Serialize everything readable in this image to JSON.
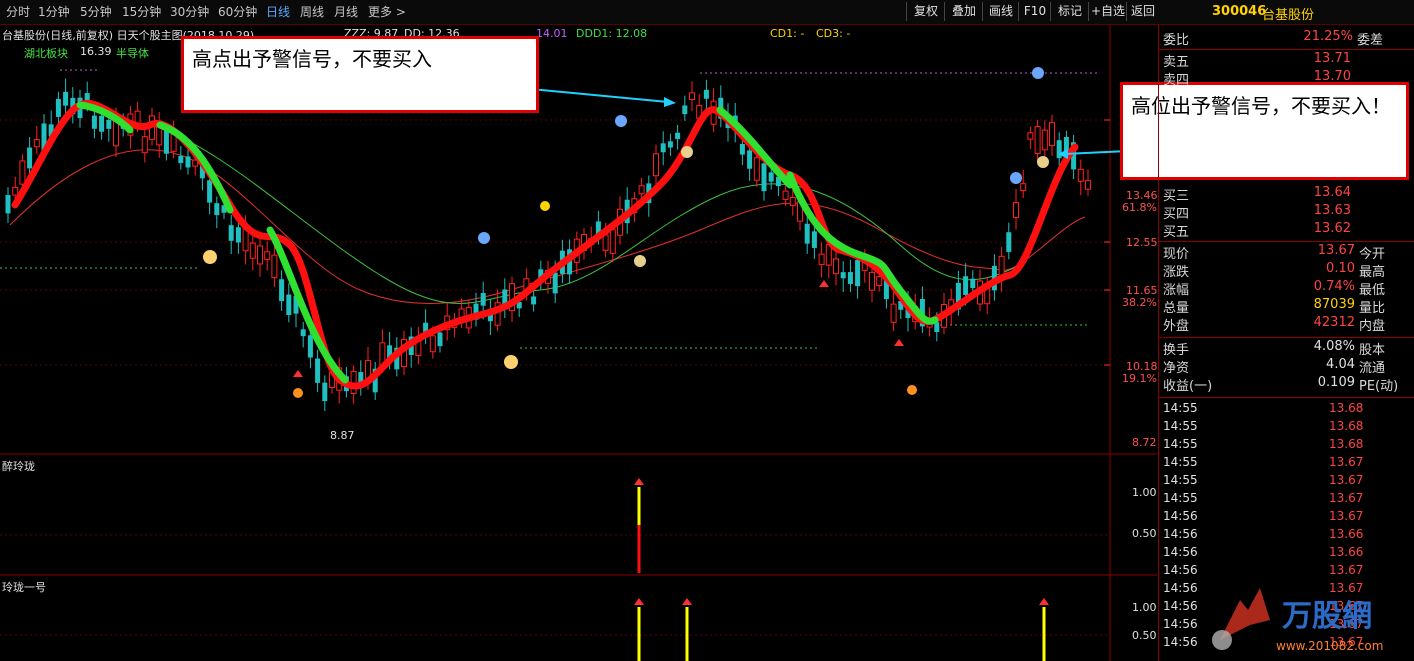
{
  "toolbar": {
    "periods": [
      "分时",
      "1分钟",
      "5分钟",
      "15分钟",
      "30分钟",
      "60分钟",
      "日线",
      "周线",
      "月线",
      "更多 >"
    ],
    "active_period": "日线",
    "buttons": [
      "复权",
      "叠加",
      "画线",
      "F10",
      "标记",
      "+自选",
      "返回"
    ]
  },
  "stock": {
    "code": "300046",
    "name": "台基股份"
  },
  "chart_header": {
    "title": "台基股份(日线,前复权) 日天个股主图(2018.10.29)",
    "zzz": "ZZZ: 9.87",
    "xx": "DD: 12.36",
    "dd2": "14.01",
    "ddd1": "DDD1: 12.08",
    "cd1": "CD1: -",
    "cd3": "CD3: -"
  },
  "sector": {
    "label1": "湖北板块",
    "label2": "半导体",
    "high_mark": "16.39",
    "low_mark": "8.87"
  },
  "price_axis": [
    {
      "value": "13.46",
      "pct": "61.8%"
    },
    {
      "value": "12.55",
      "pct": ""
    },
    {
      "value": "11.65",
      "pct": "38.2%"
    },
    {
      "value": "10.18",
      "pct": "19.1%"
    },
    {
      "value": "8.72",
      "pct": ""
    }
  ],
  "sub1": {
    "title": "醉玲珑",
    "ticks": [
      "1.00",
      "0.50"
    ]
  },
  "sub2": {
    "title": "玲珑一号",
    "ticks": [
      "1.00",
      "0.50"
    ]
  },
  "callouts": {
    "left": "高点出予警信号，不要买入",
    "right": "高位出予警信号，不要买入！"
  },
  "quote": {
    "weibi_label": "委比",
    "weibi_val": "21.25%",
    "weicha_label": "委差",
    "sell": [
      {
        "label": "卖五",
        "price": "13.71"
      },
      {
        "label": "卖四",
        "price": "13.70"
      }
    ],
    "buy": [
      {
        "label": "买三",
        "price": "13.64"
      },
      {
        "label": "买四",
        "price": "13.63"
      },
      {
        "label": "买五",
        "price": "13.62"
      }
    ],
    "stats": [
      {
        "label": "现价",
        "val": "13.67",
        "label2": "今开",
        "color": "#ff4444"
      },
      {
        "label": "涨跌",
        "val": "0.10",
        "label2": "最高",
        "color": "#ff4444"
      },
      {
        "label": "涨幅",
        "val": "0.74%",
        "label2": "最低",
        "color": "#ff4444"
      },
      {
        "label": "总量",
        "val": "87039",
        "label2": "量比",
        "color": "#ffd200"
      },
      {
        "label": "外盘",
        "val": "42312",
        "label2": "内盘",
        "color": "#ff4444"
      }
    ],
    "stats2": [
      {
        "label": "换手",
        "val": "4.08%",
        "label2": "股本"
      },
      {
        "label": "净资",
        "val": "4.04",
        "label2": "流通"
      },
      {
        "label": "收益(一)",
        "val": "0.109",
        "label2": "PE(动)"
      }
    ]
  },
  "ticks": [
    {
      "time": "14:55",
      "price": "13.68"
    },
    {
      "time": "14:55",
      "price": "13.68"
    },
    {
      "time": "14:55",
      "price": "13.68"
    },
    {
      "time": "14:55",
      "price": "13.67"
    },
    {
      "time": "14:55",
      "price": "13.67"
    },
    {
      "time": "14:55",
      "price": "13.67"
    },
    {
      "time": "14:56",
      "price": "13.67"
    },
    {
      "time": "14:56",
      "price": "13.66"
    },
    {
      "time": "14:56",
      "price": "13.66"
    },
    {
      "time": "14:56",
      "price": "13.67"
    },
    {
      "time": "14:56",
      "price": "13.67"
    },
    {
      "time": "14:56",
      "price": "13.67"
    },
    {
      "time": "14:56",
      "price": "13.67"
    },
    {
      "time": "14:56",
      "price": "13.67"
    }
  ],
  "watermark": {
    "text": "万股網",
    "url": "www.201082.com"
  }
}
